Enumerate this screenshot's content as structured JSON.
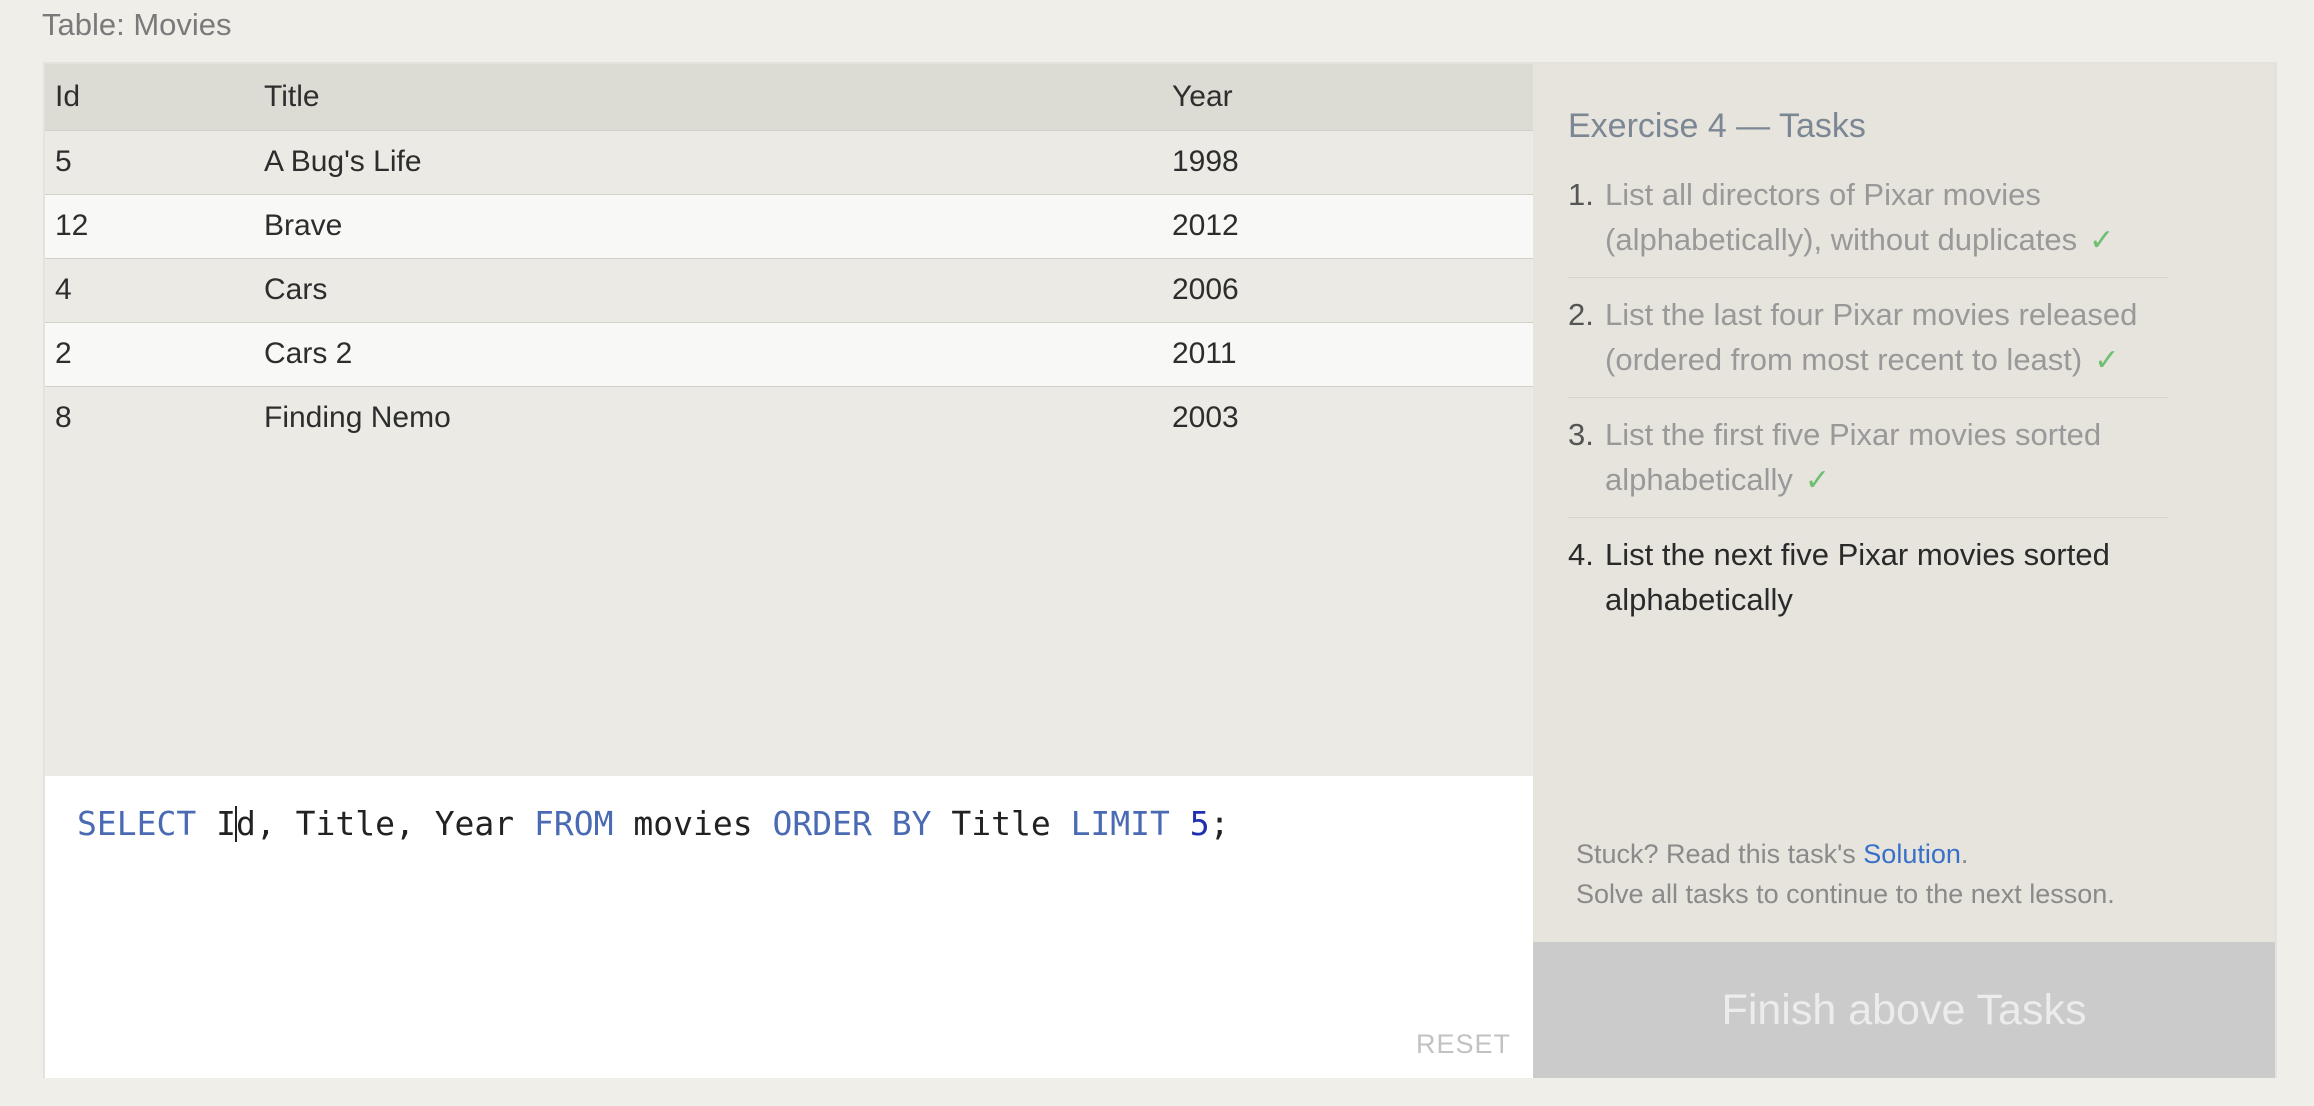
{
  "table_caption": "Table: Movies",
  "results": {
    "columns": [
      "Id",
      "Title",
      "Year"
    ],
    "rows": [
      [
        "5",
        "A Bug's Life",
        "1998"
      ],
      [
        "12",
        "Brave",
        "2012"
      ],
      [
        "4",
        "Cars",
        "2006"
      ],
      [
        "2",
        "Cars 2",
        "2011"
      ],
      [
        "8",
        "Finding Nemo",
        "2003"
      ]
    ]
  },
  "editor": {
    "query": "SELECT Id, Title, Year FROM movies ORDER BY Title LIMIT 5;",
    "reset_label": "RESET"
  },
  "tasks": {
    "title": "Exercise 4 — Tasks",
    "items": [
      {
        "num": "1.",
        "text": "List all directors of Pixar movies (alphabetically), without duplicates",
        "done": true
      },
      {
        "num": "2.",
        "text": "List the last four Pixar movies released (ordered from most recent to least)",
        "done": true
      },
      {
        "num": "3.",
        "text": "List the first five Pixar movies sorted alphabetically",
        "done": true
      },
      {
        "num": "4.",
        "text": "List the next five Pixar movies sorted alphabetically",
        "done": false
      }
    ],
    "check_mark": "✓",
    "help_prefix": "Stuck? Read this task's ",
    "help_link": "Solution",
    "help_suffix": ".",
    "help_line2": "Solve all tasks to continue to the next lesson.",
    "finish_label": "Finish above Tasks"
  },
  "colors": {
    "keyword": "#4a6bb3",
    "number": "#1f2fb0",
    "check": "#6dbf72",
    "link": "#3870c9"
  }
}
